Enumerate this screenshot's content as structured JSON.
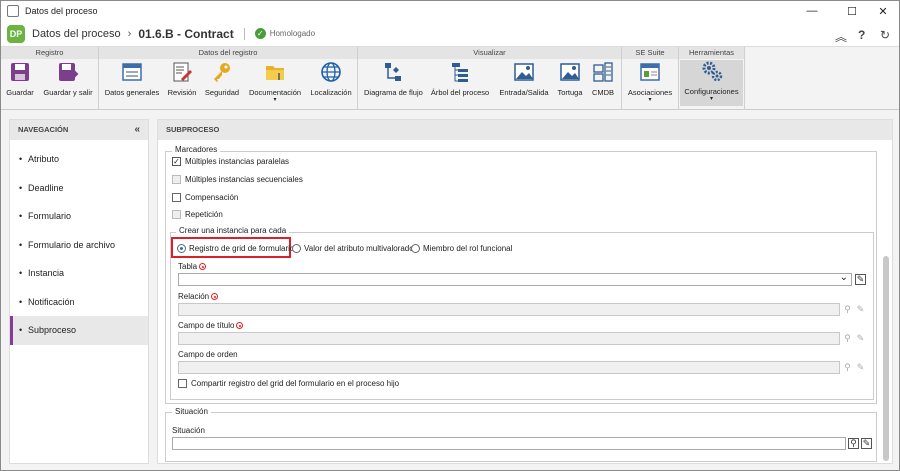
{
  "window": {
    "title": "Datos del proceso",
    "min": "—",
    "max": "☐",
    "close": "✕"
  },
  "header": {
    "logo": "DP",
    "crumb1": "Datos del proceso",
    "chevron": "›",
    "crumb2": "01.6.B - Contract",
    "status": "Homologado",
    "status_icon": "✓",
    "collapse": "︽",
    "help": "?",
    "refresh": "↻"
  },
  "ribbon": {
    "groups": [
      {
        "title": "Registro"
      },
      {
        "title": "Datos del registro"
      },
      {
        "title": "Visualizar"
      },
      {
        "title": "SE Suite"
      },
      {
        "title": "Herramientas"
      }
    ],
    "buttons": {
      "guardar": "Guardar",
      "guardar_salir": "Guardar y salir",
      "datos_generales": "Datos generales",
      "revision": "Revisión",
      "seguridad": "Seguridad",
      "documentacion": "Documentación",
      "localizacion": "Localización",
      "diagrama": "Diagrama de flujo",
      "arbol": "Árbol del proceso",
      "entrada": "Entrada/Salida",
      "tortuga": "Tortuga",
      "cmdb": "CMDB",
      "asociaciones": "Asociaciones",
      "configuraciones": "Configuraciones"
    },
    "dropdown": "▾"
  },
  "nav": {
    "title": "NAVEGACIÓN",
    "collapse": "«",
    "bullet": "•",
    "items": [
      {
        "label": "Atributo"
      },
      {
        "label": "Deadline"
      },
      {
        "label": "Formulario"
      },
      {
        "label": "Formulario de archivo"
      },
      {
        "label": "Instancia"
      },
      {
        "label": "Notificación"
      },
      {
        "label": "Subproceso"
      }
    ]
  },
  "main": {
    "title": "SUBPROCESO",
    "marcadores": {
      "legend": "Marcadores",
      "items": [
        "Múltiples instancias paralelas",
        "Múltiples instancias secuenciales",
        "Compensación",
        "Repetición"
      ],
      "check": "✓"
    },
    "crear": {
      "legend": "Crear una instancia para cada",
      "options": [
        "Registro de grid de formulario",
        "Valor del atributo multivalorado",
        "Miembro del rol funcional"
      ]
    },
    "fields": {
      "tabla": "Tabla",
      "relacion": "Relación",
      "campo_titulo": "Campo de título",
      "campo_orden": "Campo de orden",
      "tabla_value": "",
      "compartir": "Compartir registro del grid del formulario en el proceso hijo"
    },
    "situacion": {
      "legend": "Situación",
      "label": "Situación",
      "value": ""
    },
    "icons": {
      "chevron": "⌄",
      "search": "⚲",
      "clear": "✎"
    }
  },
  "colors": {
    "accent": "#8a3b9a",
    "highlight": "#d9202b",
    "radio": "#1a73c8",
    "ok": "#4a9d3a"
  }
}
